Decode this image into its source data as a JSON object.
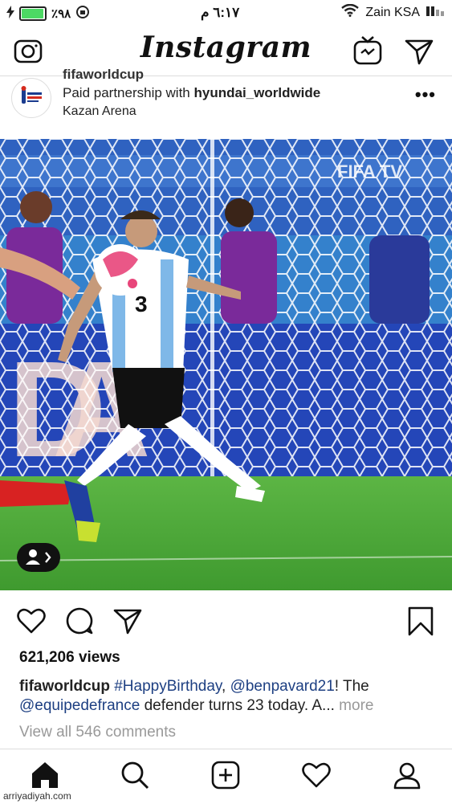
{
  "status_bar": {
    "battery_percent": "٪٩٨",
    "battery_level": 0.98,
    "time": "٦:١٧ م",
    "carrier": "Zain KSA"
  },
  "header": {
    "logo": "Instagram",
    "icons": [
      "camera-icon",
      "igtv-icon",
      "direct-message-icon"
    ]
  },
  "post": {
    "username_partial": "fifaworldcup",
    "partnership_prefix": "Paid partnership with",
    "partner": "hyundai_worldwide",
    "location": "Kazan Arena",
    "media": {
      "overlay_text": "FIFA TV",
      "player_number": "3"
    },
    "views": "621,206 views",
    "caption": {
      "user": "fifaworldcup",
      "hashtag": "#HappyBirthday",
      "sep1": ",",
      "mention1": "@benpavard21",
      "text1": "! The",
      "mention2": "@equipedefrance",
      "text2": "defender turns 23 today. A...",
      "more": "more"
    },
    "view_all_comments": "View all 546 comments"
  },
  "tab_bar": {
    "items": [
      "home-icon",
      "search-icon",
      "add-post-icon",
      "activity-heart-icon",
      "profile-icon"
    ]
  },
  "watermark": "arriyadiyah.com",
  "colors": {
    "link": "#1d3f82",
    "muted": "#999999",
    "pitch": "#4fa83a",
    "stand": "#2a56b0"
  }
}
